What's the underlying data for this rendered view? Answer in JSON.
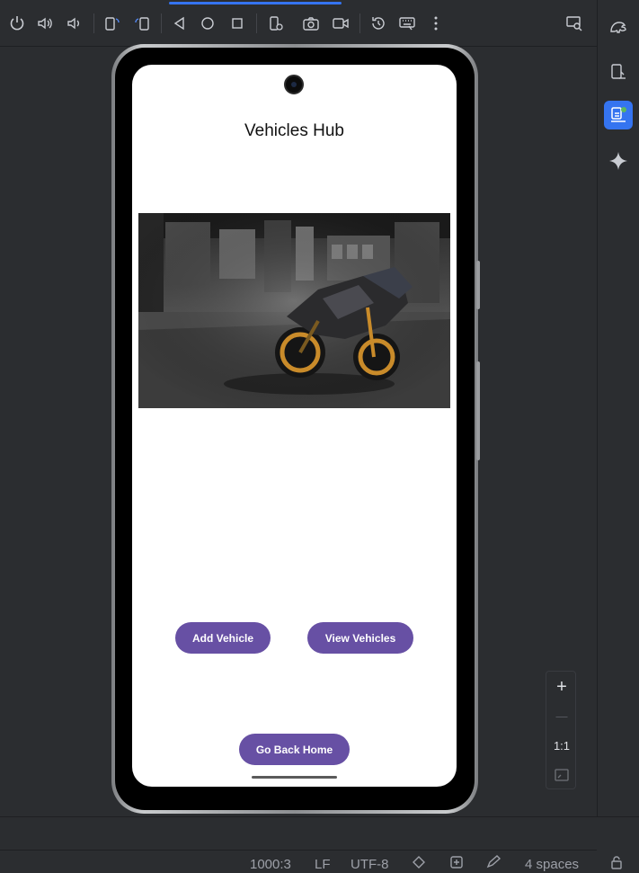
{
  "toolbar": {
    "icons": [
      "power-icon",
      "volume-up-icon",
      "volume-down-icon",
      "rotate-left-icon",
      "rotate-right-icon",
      "back-icon",
      "home-icon",
      "overview-icon",
      "device-settings-icon",
      "camera-icon",
      "video-icon",
      "reset-icon",
      "keyboard-icon",
      "more-icon",
      "find-icon"
    ]
  },
  "rightbar": {
    "icons": [
      "gradle-icon",
      "device-manager-icon",
      "running-devices-icon",
      "gemini-icon"
    ]
  },
  "app": {
    "title": "Vehicles Hub",
    "add_button": "Add Vehicle",
    "view_button": "View Vehicles",
    "home_button": "Go Back Home"
  },
  "zoom": {
    "plus": "+",
    "minus": "—",
    "one_to_one": "1:1"
  },
  "statusbar": {
    "position": "1000:3",
    "line_sep": "LF",
    "encoding": "UTF-8",
    "indent": "4 spaces"
  },
  "colors": {
    "accent": "#3574f0",
    "button": "#6750a4",
    "background": "#2b2d30"
  }
}
